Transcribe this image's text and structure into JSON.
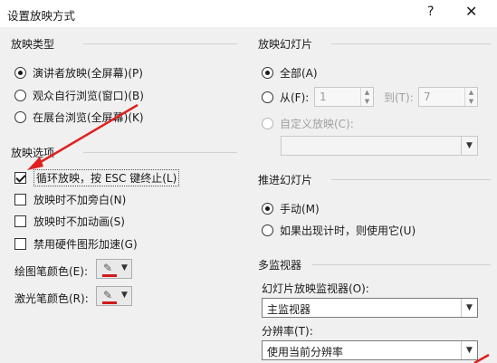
{
  "dialog": {
    "title": "设置放映方式",
    "help": "?",
    "close": "✕"
  },
  "show_type": {
    "title": "放映类型",
    "options": [
      {
        "label": "演讲者放映(全屏幕)(P)",
        "selected": true
      },
      {
        "label": "观众自行浏览(窗口)(B)",
        "selected": false
      },
      {
        "label": "在展台浏览(全屏幕)(K)",
        "selected": false
      }
    ]
  },
  "show_options": {
    "title": "放映选项",
    "checkboxes": [
      {
        "label": "循环放映，按 ESC 键终止(L)",
        "checked": true
      },
      {
        "label": "放映时不加旁白(N)",
        "checked": false
      },
      {
        "label": "放映时不加动画(S)",
        "checked": false
      },
      {
        "label": "禁用硬件图形加速(G)",
        "checked": false
      }
    ],
    "pen_color_label": "绘图笔颜色(E):",
    "laser_color_label": "激光笔颜色(R):",
    "pen_color": "#d11a1a",
    "laser_color": "#d11a1a"
  },
  "show_slides": {
    "title": "放映幻灯片",
    "all_label": "全部(A)",
    "from_label": "从(F):",
    "from_value": "1",
    "to_label": "到(T):",
    "to_value": "7",
    "custom_label": "自定义放映(C):"
  },
  "advance": {
    "title": "推进幻灯片",
    "options": [
      {
        "label": "手动(M)",
        "selected": true
      },
      {
        "label": "如果出现计时，则使用它(U)",
        "selected": false
      }
    ]
  },
  "monitors": {
    "title": "多监视器",
    "monitor_label": "幻灯片放映监视器(O):",
    "monitor_value": "主监视器",
    "resolution_label": "分辨率(T):",
    "resolution_value": "使用当前分辨率"
  },
  "annotation": {
    "arrow_color": "#e02020"
  }
}
